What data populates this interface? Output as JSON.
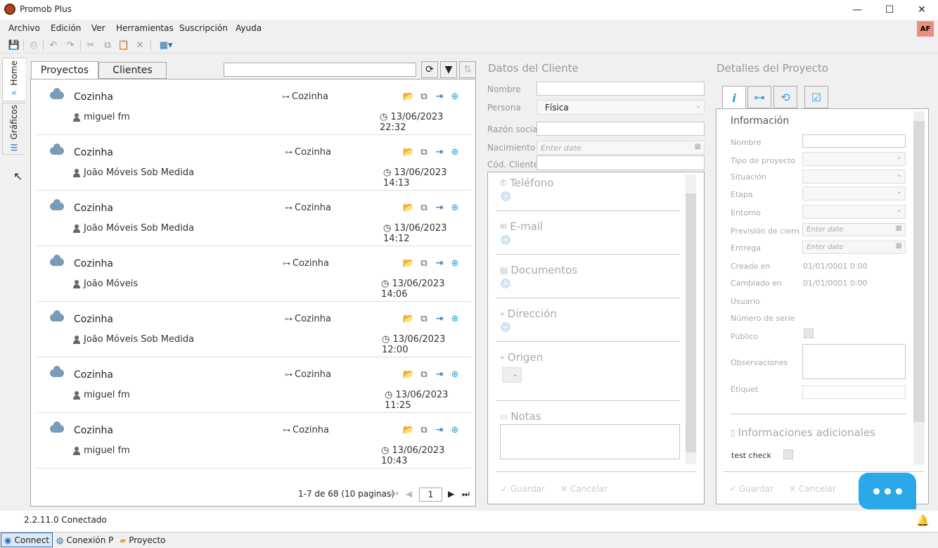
{
  "window": {
    "title": "Promob Plus",
    "minimize": "—",
    "maximize": "☐",
    "close": "✕"
  },
  "menu": [
    "Archivo",
    "Edición",
    "Ver",
    "Herramientas",
    "Suscripción",
    "Ayuda"
  ],
  "user_badge": "AF",
  "side_tabs": [
    {
      "label": "Home",
      "icon": "home-icon"
    },
    {
      "label": "Gráficos",
      "icon": "chart-icon"
    }
  ],
  "projects_panel": {
    "tabs": [
      "Proyectos",
      "Clientes"
    ],
    "search_value": "",
    "items": [
      {
        "name": "Cozinha",
        "project": "Cozinha",
        "user": "miguel fm",
        "date": "13/06/2023 22:32"
      },
      {
        "name": "Cozinha",
        "project": "Cozinha",
        "user": "João Móveis Sob Medida",
        "date": "13/06/2023 14:13"
      },
      {
        "name": "Cozinha",
        "project": "Cozinha",
        "user": "João Móveis Sob Medida",
        "date": "13/06/2023 14:12"
      },
      {
        "name": "Cozinha",
        "project": "Cozinha",
        "user": "João Móveis",
        "date": "13/06/2023 14:06"
      },
      {
        "name": "Cozinha",
        "project": "Cozinha",
        "user": "João Móveis Sob Medida",
        "date": "13/06/2023 12:00"
      },
      {
        "name": "Cozinha",
        "project": "Cozinha",
        "user": "miguel fm",
        "date": "13/06/2023 11:25"
      },
      {
        "name": "Cozinha",
        "project": "Cozinha",
        "user": "miguel fm",
        "date": "13/06/2023 10:43"
      }
    ],
    "pagination": {
      "summary": "1-7 de 68 (10 paginas)",
      "page": "1"
    }
  },
  "client_panel": {
    "title": "Datos del Cliente",
    "fields": {
      "nombre": {
        "label": "Nombre",
        "value": ""
      },
      "persona": {
        "label": "Persona",
        "value": "Física"
      },
      "razon": {
        "label": "Razón social",
        "value": ""
      },
      "nacimiento": {
        "label": "Nacimiento",
        "placeholder": "Enter date"
      },
      "cod": {
        "label": "Cód. Cliente",
        "value": ""
      }
    },
    "sections": [
      "Teléfono",
      "E-mail",
      "Documentos",
      "Dirección",
      "Origen",
      "Notas"
    ],
    "save": "Guardar",
    "cancel": "Cancelar"
  },
  "detail_panel": {
    "title": "Detalles del Proyecto",
    "section": "Información",
    "labels": {
      "nombre": "Nombre",
      "tipo": "Tipo de proyecto",
      "situacion": "Situación",
      "etapa": "Etapa",
      "entorno": "Entorno",
      "prevision": "Previsión de cierre",
      "entrega": "Entrega",
      "creado": "Creado en",
      "cambiado": "Cambiado en",
      "usuario": "Usuario",
      "serie": "Número de serie",
      "publico": "Público",
      "observaciones": "Observaciones",
      "etiqueta": "Etiqueta"
    },
    "date_placeholder": "Enter date",
    "creado_value": "01/01/0001 0:00",
    "cambiado_value": "01/01/0001 0:00",
    "extra_title": "Informaciones adicionales",
    "test_check": "test check",
    "save": "Guardar",
    "cancel": "Cancelar"
  },
  "status": "2.2.11.0 Conectado",
  "taskbar": [
    "Connect",
    "Conexión P",
    "Proyecto"
  ],
  "colors": {
    "accent": "#2aa8e8",
    "folder": "#e8a33c",
    "badge": "#e98f7d"
  }
}
